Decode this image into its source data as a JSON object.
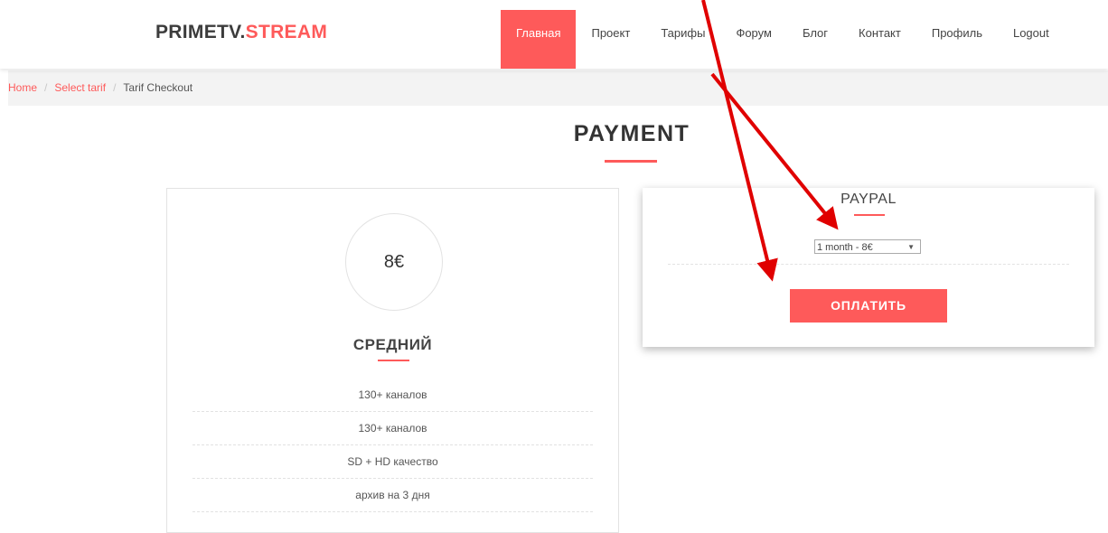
{
  "header": {
    "logo_main": "PRIMETV.",
    "logo_accent": "STREAM",
    "nav": [
      {
        "label": "Главная",
        "active": true
      },
      {
        "label": "Проект"
      },
      {
        "label": "Тарифы"
      },
      {
        "label": "Форум"
      },
      {
        "label": "Блог"
      },
      {
        "label": "Контакт"
      },
      {
        "label": "Профиль"
      },
      {
        "label": "Logout"
      }
    ]
  },
  "breadcrumb": {
    "items": [
      "Home",
      "Select tarif"
    ],
    "separator": "/",
    "current": "Tarif Checkout"
  },
  "page": {
    "title": "PAYMENT"
  },
  "tariff": {
    "price": "8€",
    "name": "СРЕДНИЙ",
    "features": [
      "130+ каналов",
      "130+ каналов",
      "SD + HD качество",
      "архив на 3 дня"
    ]
  },
  "paypal": {
    "title": "PAYPAL",
    "period_selected": "1 month - 8€",
    "pay_label": "ОПЛАТИТЬ"
  },
  "colors": {
    "accent": "#fe5a5a",
    "annotation": "#e00000"
  },
  "icons": {
    "select_arrow": "▼"
  }
}
